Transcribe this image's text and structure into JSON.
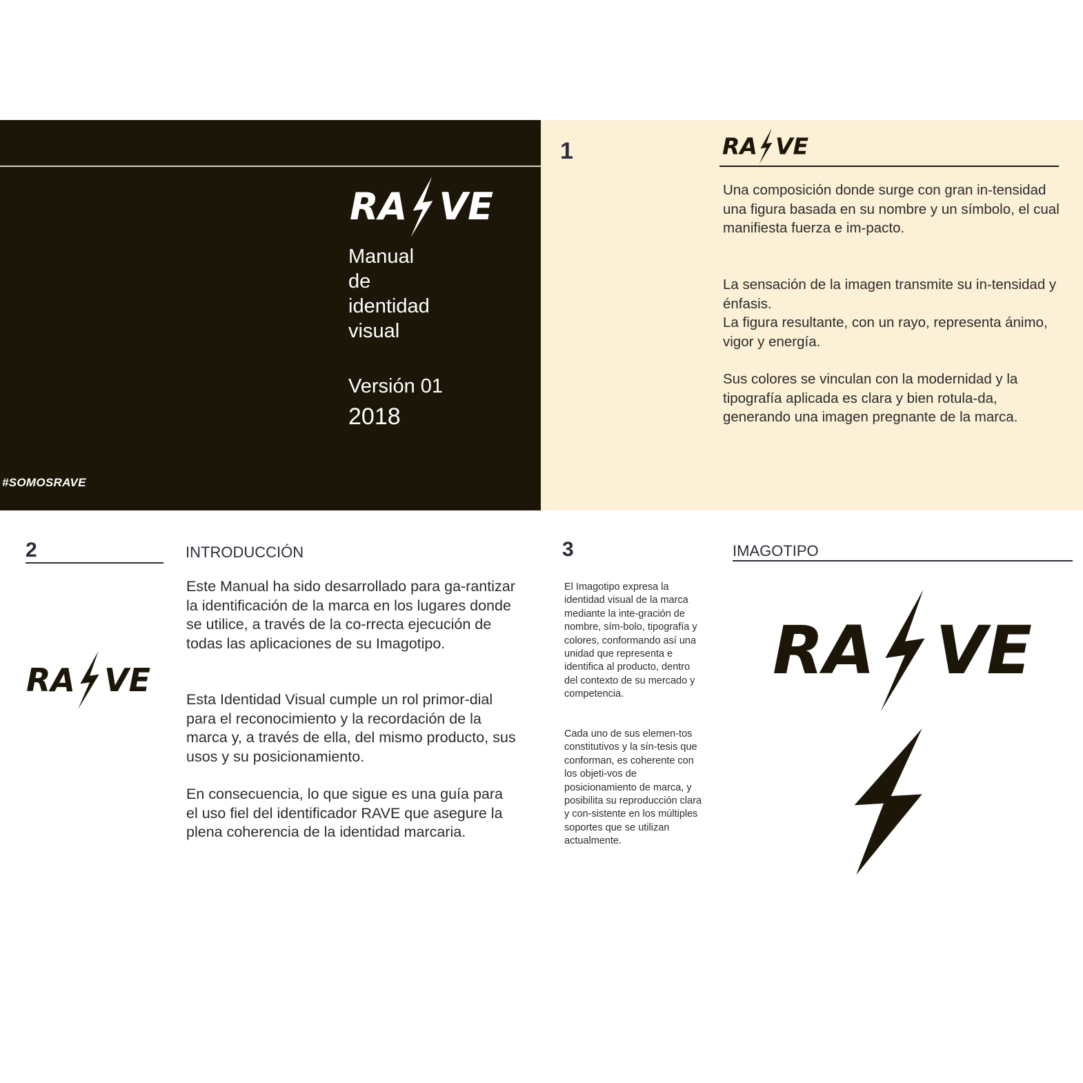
{
  "brand": {
    "name_left": "RA",
    "name_right": "VE"
  },
  "cover": {
    "title_lines": [
      "Manual",
      "de",
      "identidad",
      "visual"
    ],
    "version": "Versión 01",
    "year": "2018",
    "hashtag": "#SOMOSRAVE"
  },
  "page1": {
    "number": "1",
    "paragraphs": [
      "Una composición donde surge con gran in-tensidad una figura basada en su nombre y un símbolo, el cual manifiesta fuerza e im-pacto.",
      "La sensación de la imagen transmite su in-tensidad y énfasis.",
      "La figura resultante, con un rayo, representa ánimo, vigor y energía.",
      "Sus colores se vinculan con la modernidad y la tipografía aplicada es clara y bien rotula-da, generando una imagen pregnante de la marca."
    ]
  },
  "page2": {
    "number": "2",
    "heading": "INTRODUCCIÓN",
    "paragraphs": [
      "Este Manual ha sido desarrollado para ga-rantizar la identificación de la marca en los lugares donde se utilice, a través de la co-rrecta ejecución de todas las aplicaciones de su Imagotipo.",
      "Esta Identidad Visual cumple un rol primor-dial para el reconocimiento y la recordación de la marca y, a través de ella, del mismo producto, sus usos y su posicionamiento.",
      "En consecuencia, lo que sigue es una guía para el uso fiel del identificador RAVE que asegure la plena coherencia de la identidad marcaria."
    ]
  },
  "page3": {
    "number": "3",
    "heading": "IMAGOTIPO",
    "paragraphs": [
      "El Imagotipo expresa la identidad visual de la marca mediante la inte-gración de nombre, sím-bolo, tipografía y colores, conformando así una unidad que representa e identifica al producto, dentro del contexto de su mercado y competencia.",
      "Cada uno de sus elemen-tos constitutivos y la sín-tesis que conforman, es coherente con los objeti-vos de posicionamiento de marca, y posibilita su reproducción clara y con-sistente en los múltiples soportes que se utilizan actualmente."
    ]
  },
  "colors": {
    "dark": "#1c1608",
    "cream": "#fcf0d6",
    "text": "#2b2b2b"
  }
}
